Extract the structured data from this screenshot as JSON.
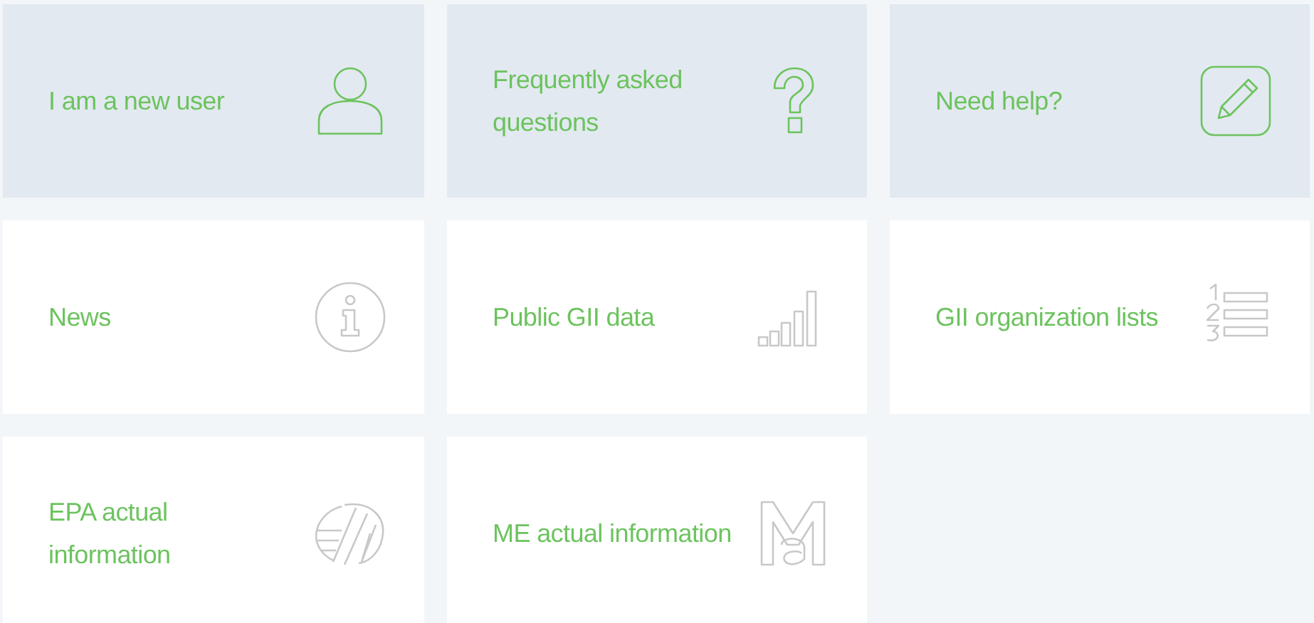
{
  "tiles": [
    {
      "label": "I am a new user",
      "kind": "user",
      "featured": true
    },
    {
      "label": "Frequently asked questions",
      "kind": "question",
      "featured": true
    },
    {
      "label": "Need help?",
      "kind": "pencil",
      "featured": true
    },
    {
      "label": "News",
      "kind": "info",
      "featured": false
    },
    {
      "label": "Public GII data",
      "kind": "bars",
      "featured": false
    },
    {
      "label": "GII organization lists",
      "kind": "list",
      "featured": false
    },
    {
      "label": "EPA actual information",
      "kind": "epa",
      "featured": false
    },
    {
      "label": "ME actual information",
      "kind": "me",
      "featured": false
    }
  ]
}
